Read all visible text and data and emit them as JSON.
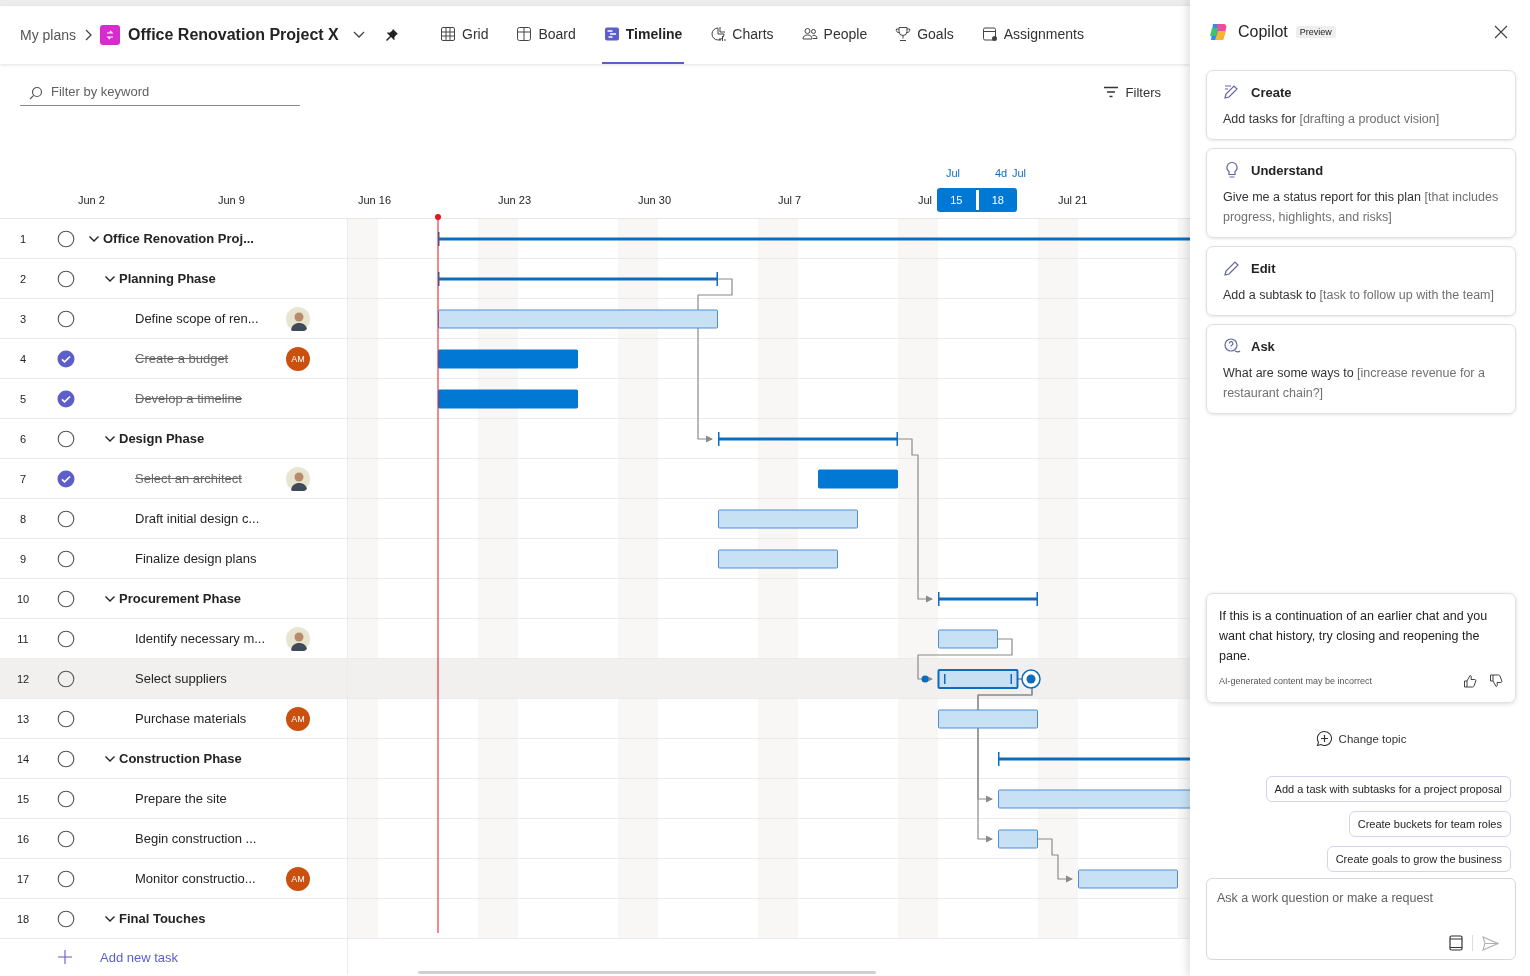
{
  "breadcrumb": {
    "root": "My plans",
    "plan_title": "Office Renovation Project X"
  },
  "views": [
    {
      "label": "Grid",
      "selected": false
    },
    {
      "label": "Board",
      "selected": false
    },
    {
      "label": "Timeline",
      "selected": true
    },
    {
      "label": "Charts",
      "selected": false
    },
    {
      "label": "People",
      "selected": false
    },
    {
      "label": "Goals",
      "selected": false
    },
    {
      "label": "Assignments",
      "selected": false
    }
  ],
  "filter": {
    "placeholder": "Filter by keyword"
  },
  "filters_button": "Filters",
  "scale": {
    "ticks": [
      "Jun 2",
      "Jun 9",
      "Jun 16",
      "Jun 23",
      "Jun 30",
      "Jul 7",
      "Jul",
      "Jul 21"
    ],
    "selection": {
      "start_month": "Jul",
      "start_day": "15",
      "length": "4d",
      "end_month": "Jul",
      "end_day": "18"
    }
  },
  "tasks": [
    {
      "number": "1",
      "name": "Office Renovation Proj...",
      "kind": "summary",
      "completed": false,
      "expanded": true,
      "children": [
        {
          "number": "2",
          "name": "Planning Phase",
          "kind": "summary",
          "completed": false,
          "expanded": true,
          "children": [
            {
              "number": "3",
              "name": "Define scope of ren...",
              "kind": "task",
              "completed": false,
              "selected": false,
              "assignee": {
                "kind": "photo"
              }
            },
            {
              "number": "4",
              "name": "Create a budget",
              "kind": "task",
              "completed": true,
              "selected": false,
              "assignee": {
                "kind": "initials",
                "initials": "AM"
              }
            },
            {
              "number": "5",
              "name": "Develop a timeline",
              "kind": "task",
              "completed": true,
              "selected": false
            }
          ]
        },
        {
          "number": "6",
          "name": "Design Phase",
          "kind": "summary",
          "completed": false,
          "expanded": true,
          "children": [
            {
              "number": "7",
              "name": "Select an architect",
              "kind": "task",
              "completed": true,
              "selected": false,
              "assignee": {
                "kind": "photo"
              }
            },
            {
              "number": "8",
              "name": "Draft initial design c...",
              "kind": "task",
              "completed": false,
              "selected": false
            },
            {
              "number": "9",
              "name": "Finalize design plans",
              "kind": "task",
              "completed": false,
              "selected": false
            }
          ]
        },
        {
          "number": "10",
          "name": "Procurement Phase",
          "kind": "summary",
          "completed": false,
          "expanded": true,
          "children": [
            {
              "number": "11",
              "name": "Identify necessary m...",
              "kind": "task",
              "completed": false,
              "selected": false,
              "assignee": {
                "kind": "photo"
              }
            },
            {
              "number": "12",
              "name": "Select suppliers",
              "kind": "task",
              "completed": false,
              "selected": true
            },
            {
              "number": "13",
              "name": "Purchase materials",
              "kind": "task",
              "completed": false,
              "selected": false,
              "assignee": {
                "kind": "initials",
                "initials": "AM"
              }
            }
          ]
        },
        {
          "number": "14",
          "name": "Construction Phase",
          "kind": "summary",
          "completed": false,
          "expanded": true,
          "children": [
            {
              "number": "15",
              "name": "Prepare the site",
              "kind": "task",
              "completed": false,
              "selected": false
            },
            {
              "number": "16",
              "name": "Begin construction ...",
              "kind": "task",
              "completed": false,
              "selected": false
            },
            {
              "number": "17",
              "name": "Monitor constructio...",
              "kind": "task",
              "completed": false,
              "selected": false,
              "assignee": {
                "kind": "initials",
                "initials": "AM"
              }
            }
          ]
        },
        {
          "number": "18",
          "name": "Final Touches",
          "kind": "summary",
          "completed": false,
          "expanded": true
        }
      ]
    }
  ],
  "add_task": "Add new task",
  "copilot": {
    "title": "Copilot",
    "badge": "Preview",
    "cards": [
      {
        "title": "Create",
        "lead": "Add tasks for ",
        "hint": "[drafting a product vision]"
      },
      {
        "title": "Understand",
        "lead": "Give me a status report for this plan ",
        "hint": "[that includes progress, highlights, and risks]"
      },
      {
        "title": "Edit",
        "lead": "Add a subtask to ",
        "hint": "[task to follow up with the team]"
      },
      {
        "title": "Ask",
        "lead": "What are some ways to ",
        "hint": "[increase revenue for a restaurant chain?]"
      }
    ],
    "notice": "If this is a continuation of an earlier chat and you want chat history, try closing and reopening the pane.",
    "disclaimer": "AI-generated content may be incorrect",
    "change_topic": "Change topic",
    "suggestions": [
      "Add a task with subtasks for a project proposal",
      "Create buckets for team roles",
      "Create goals to grow the business"
    ],
    "input": {
      "placeholder": "Ask a work question or make a request"
    }
  }
}
